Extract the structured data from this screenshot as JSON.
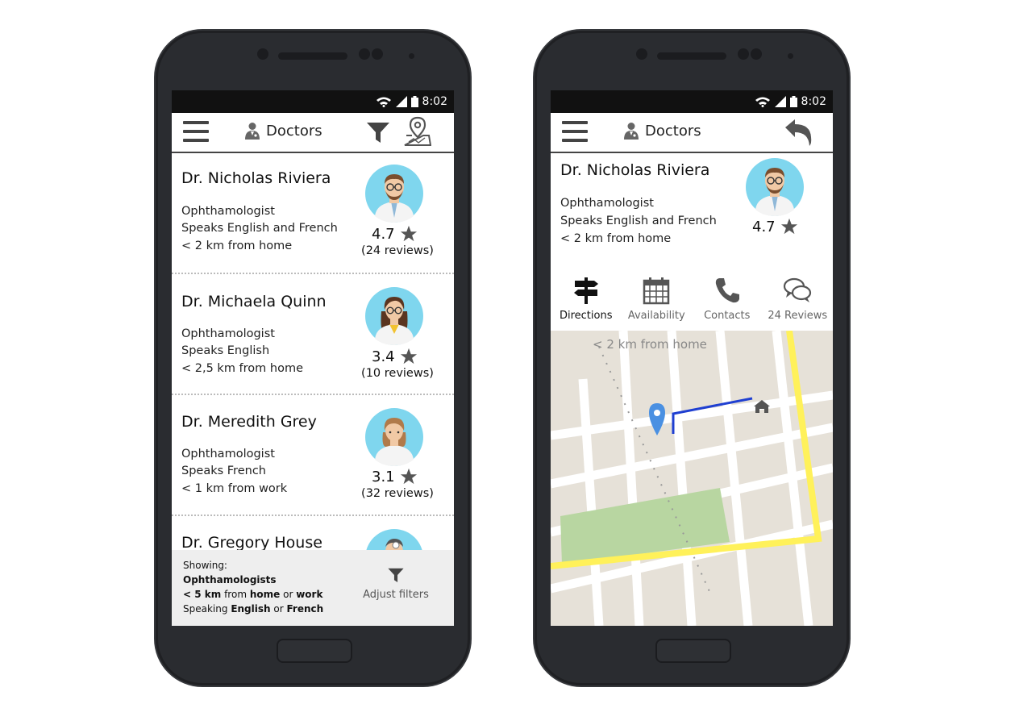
{
  "status_bar": {
    "time": "8:02"
  },
  "left_screen": {
    "title": "Doctors",
    "doctors": [
      {
        "name": "Dr. Nicholas Riviera",
        "specialty": "Ophthamologist",
        "languages": "Speaks English and French",
        "distance": "< 2 km from home",
        "rating": "4.7",
        "reviews": "(24 reviews)"
      },
      {
        "name": "Dr. Michaela Quinn",
        "specialty": "Ophthamologist",
        "languages": "Speaks English",
        "distance": "< 2,5 km from home",
        "rating": "3.4",
        "reviews": "(10 reviews)"
      },
      {
        "name": "Dr. Meredith Grey",
        "specialty": "Ophthamologist",
        "languages": "Speaks French",
        "distance": "< 1 km from work",
        "rating": "3.1",
        "reviews": "(32 reviews)"
      },
      {
        "name": "Dr. Gregory House"
      }
    ],
    "filter_summary": {
      "showing": "Showing:",
      "specialty": "Ophthamologists",
      "distance_prefix": "< 5 km",
      "distance_from": "from",
      "distance_home": "home",
      "distance_or": "or",
      "distance_work": "work",
      "speaking": "Speaking",
      "language1": "English",
      "language_or": "or",
      "language2": "French"
    },
    "adjust_filters_label": "Adjust filters"
  },
  "right_screen": {
    "title": "Doctors",
    "doctor": {
      "name": "Dr. Nicholas Riviera",
      "specialty": "Ophthamologist",
      "languages": "Speaks English and French",
      "distance": "< 2 km from home",
      "rating": "4.7"
    },
    "tabs": [
      {
        "label": "Directions",
        "icon": "signpost-icon"
      },
      {
        "label": "Availability",
        "icon": "calendar-icon"
      },
      {
        "label": "Contacts",
        "icon": "phone-icon"
      },
      {
        "label": "24 Reviews",
        "icon": "chat-bubbles-icon"
      }
    ],
    "map_label": "< 2 km from home"
  },
  "colors": {
    "avatar_bg": "#7fd6ee",
    "route": "#1f3fd1",
    "highway": "#fff15a",
    "park": "#b8d6a1",
    "pin": "#4a90e2"
  }
}
